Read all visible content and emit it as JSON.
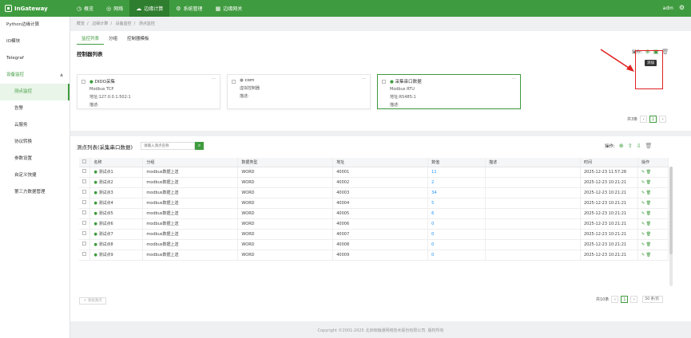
{
  "app": {
    "logo": "InGateway",
    "user": "adm"
  },
  "nav": [
    "概览",
    "网络",
    "边缘计算",
    "系统管理",
    "边缘网关"
  ],
  "sidebar": {
    "items": [
      "Python边缘计算",
      "IO模块",
      "Telegraf",
      "设备监控",
      "测点监控",
      "告警",
      "云服务",
      "协议转换",
      "参数设置",
      "自定义快捷",
      "第三方数据管理"
    ]
  },
  "breadcrumb": [
    "概览",
    "边缘计算",
    "设备监控",
    "测点监控"
  ],
  "tabs": [
    "监控列表",
    "分组",
    "控制器模板"
  ],
  "controllers": {
    "title": "控制器列表",
    "ops_label": "操作:",
    "tooltip": "添加",
    "cards": [
      {
        "name": "DIDO采集",
        "line1": "Modbus TCP",
        "line2": "地址:127.0.0.1:502:1",
        "line3": "描述:"
      },
      {
        "name": "com",
        "line1": "虚拟控制器",
        "line2": "",
        "line3": "描述:"
      },
      {
        "name": "采集串口数据",
        "line1": "Modbus RTU",
        "line2": "地址:RS485:1",
        "line3": "描述:"
      }
    ],
    "total": "共3条",
    "page": "1"
  },
  "points": {
    "title": "测点列表(采集串口数据)",
    "search_placeholder": "请输入测点名称",
    "ops_label": "操作:",
    "headers": [
      "名称",
      "分组",
      "数据类型",
      "地址",
      "数值",
      "描述",
      "时间",
      "操作"
    ],
    "rows": [
      {
        "name": "测试点1",
        "group": "modbus数据上送",
        "type": "WORD",
        "addr": "40001",
        "value": "11",
        "desc": "",
        "time": "2025-12-23 11:57:28"
      },
      {
        "name": "测试点2",
        "group": "modbus数据上送",
        "type": "WORD",
        "addr": "40002",
        "value": "2",
        "desc": "",
        "time": "2025-12-23 10:21:21"
      },
      {
        "name": "测试点3",
        "group": "modbus数据上送",
        "type": "WORD",
        "addr": "40003",
        "value": "34",
        "desc": "",
        "time": "2025-12-23 10:21:21"
      },
      {
        "name": "测试点4",
        "group": "modbus数据上送",
        "type": "WORD",
        "addr": "40004",
        "value": "5",
        "desc": "",
        "time": "2025-12-23 10:21:21"
      },
      {
        "name": "测试点5",
        "group": "modbus数据上送",
        "type": "WORD",
        "addr": "40005",
        "value": "6",
        "desc": "",
        "time": "2025-12-23 10:21:21"
      },
      {
        "name": "测试点6",
        "group": "modbus数据上送",
        "type": "WORD",
        "addr": "40006",
        "value": "0",
        "desc": "",
        "time": "2025-12-23 10:21:21"
      },
      {
        "name": "测试点7",
        "group": "modbus数据上送",
        "type": "WORD",
        "addr": "40007",
        "value": "0",
        "desc": "",
        "time": "2025-12-23 10:21:21"
      },
      {
        "name": "测试点8",
        "group": "modbus数据上送",
        "type": "WORD",
        "addr": "40008",
        "value": "0",
        "desc": "",
        "time": "2025-12-23 10:21:21"
      },
      {
        "name": "测试点9",
        "group": "modbus数据上送",
        "type": "WORD",
        "addr": "40009",
        "value": "0",
        "desc": "",
        "time": "2025-12-23 10:21:21"
      }
    ],
    "add_label": "+ 添加测点",
    "total": "共10条",
    "page": "1",
    "per_page": "50 条/页"
  },
  "footer": "Copyright ©2001-2025 北京映翰通网络技术股份有限公司. 版权所有",
  "colors": {
    "primary": "#3f9b3f",
    "highlight": "#e02020"
  }
}
